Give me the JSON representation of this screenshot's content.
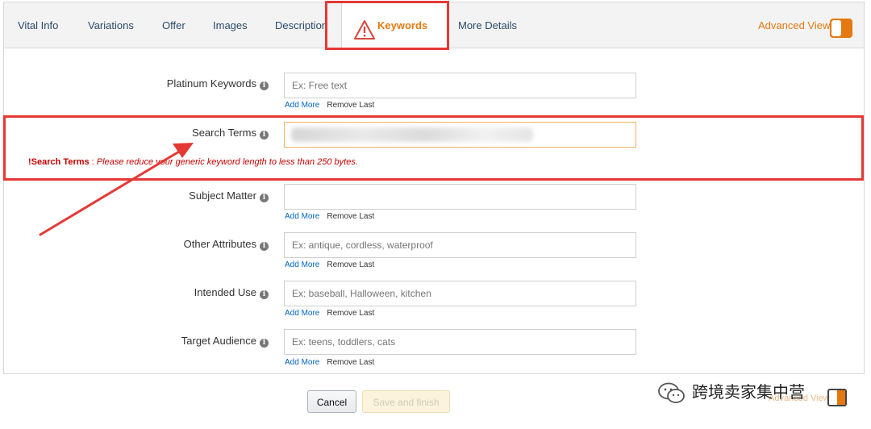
{
  "tabs": [
    {
      "label": "Vital Info",
      "active": false
    },
    {
      "label": "Variations",
      "active": false
    },
    {
      "label": "Offer",
      "active": false
    },
    {
      "label": "Images",
      "active": false
    },
    {
      "label": "Description",
      "active": false
    },
    {
      "label": "Keywords",
      "active": true
    },
    {
      "label": "More Details",
      "active": false
    }
  ],
  "advanced_view": {
    "label": "Advanced View",
    "enabled": true
  },
  "fields": [
    {
      "label": "Platinum Keywords",
      "placeholder": "Ex: Free text",
      "add_more": "Add More",
      "remove_last": "Remove Last"
    },
    {
      "label": "Search Terms",
      "placeholder": "",
      "error": true
    },
    {
      "label": "Subject Matter",
      "placeholder": "",
      "add_more": "Add More",
      "remove_last": "Remove Last"
    },
    {
      "label": "Other Attributes",
      "placeholder": "Ex: antique, cordless, waterproof",
      "add_more": "Add More",
      "remove_last": "Remove Last"
    },
    {
      "label": "Intended Use",
      "placeholder": "Ex: baseball, Halloween, kitchen",
      "add_more": "Add More",
      "remove_last": "Remove Last"
    },
    {
      "label": "Target Audience",
      "placeholder": "Ex: teens, toddlers, cats",
      "add_more": "Add More",
      "remove_last": "Remove Last"
    }
  ],
  "error": {
    "prefix": "!",
    "field": "Search Terms",
    "separator": " : ",
    "message": "Please reduce your generic keyword length to less than 250 bytes."
  },
  "buttons": {
    "cancel": "Cancel",
    "save": "Save and finish"
  },
  "watermark": {
    "text": "跨境卖家集中营",
    "overlay_label": "Advanced View"
  },
  "colors": {
    "accent": "#e47911",
    "highlight": "#e53935",
    "link": "#0066c0",
    "error": "#c40000"
  }
}
